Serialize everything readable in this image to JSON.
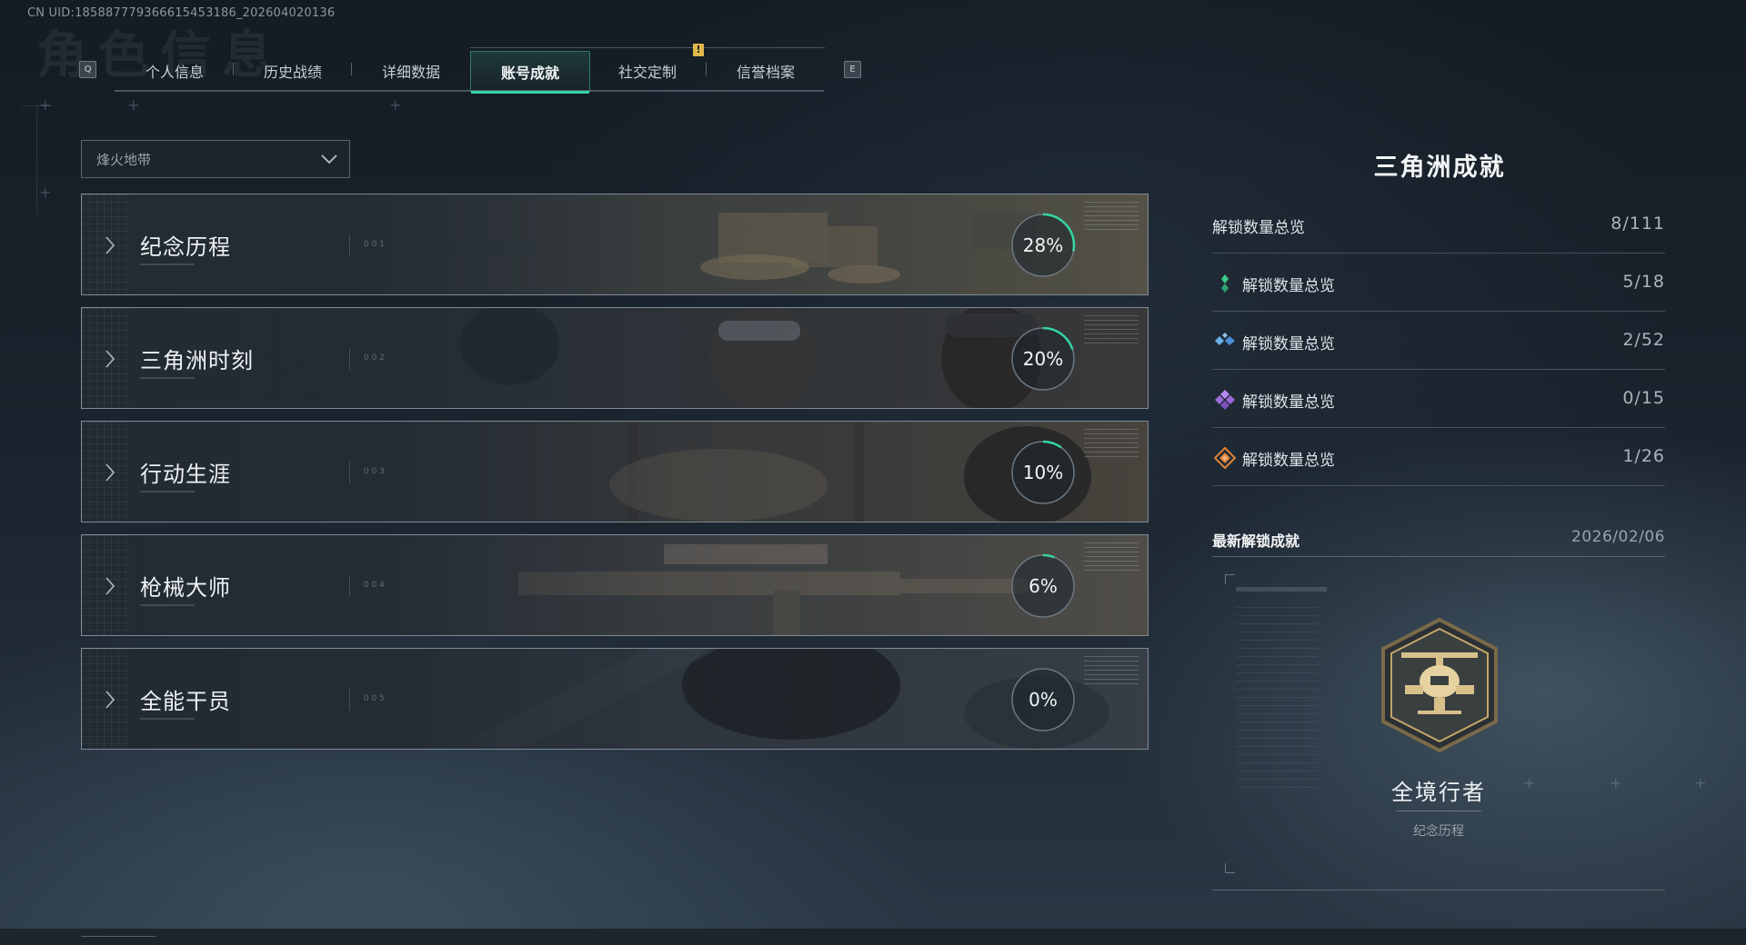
{
  "header": {
    "uid_text": "CN UID:1858877793666154531​86_202604020136",
    "page_title_watermark": "角色信息",
    "prev_key": "Q",
    "next_key": "E",
    "notice_mark": "!"
  },
  "tabs": [
    {
      "label": "个人信息",
      "active": false
    },
    {
      "label": "历史战绩",
      "active": false
    },
    {
      "label": "详细数据",
      "active": false
    },
    {
      "label": "账号成就",
      "active": true
    },
    {
      "label": "社交定制",
      "active": false
    },
    {
      "label": "信誉档案",
      "active": false
    }
  ],
  "filter": {
    "selected": "烽火地带",
    "icon": "chevron-down-icon"
  },
  "categories": [
    {
      "name": "纪念历程",
      "index": "0 0 1",
      "percent": 28,
      "percent_label": "28%"
    },
    {
      "name": "三角洲时刻",
      "index": "0 0 2",
      "percent": 20,
      "percent_label": "20%"
    },
    {
      "name": "行动生涯",
      "index": "0 0 3",
      "percent": 10,
      "percent_label": "10%"
    },
    {
      "name": "枪械大师",
      "index": "0 0 4",
      "percent": 6,
      "percent_label": "6%"
    },
    {
      "name": "全能干员",
      "index": "0 0 5",
      "percent": 0,
      "percent_label": "0%"
    }
  ],
  "panel": {
    "title": "三角洲成就",
    "stats": [
      {
        "label": "解锁数量总览",
        "value": "8/111",
        "icon": "none",
        "color": ""
      },
      {
        "label": "解锁数量总览",
        "value": "5/18",
        "icon": "green-tier-icon",
        "color": "#3fc98a"
      },
      {
        "label": "解锁数量总览",
        "value": "2/52",
        "icon": "blue-tier-icon",
        "color": "#4a8fd6"
      },
      {
        "label": "解锁数量总览",
        "value": "0/15",
        "icon": "purple-tier-icon",
        "color": "#9a6ad8"
      },
      {
        "label": "解锁数量总览",
        "value": "1/26",
        "icon": "orange-tier-icon",
        "color": "#e0843a"
      }
    ],
    "latest_title": "最新解锁成就",
    "latest_date": "2026/02/06",
    "latest_achievement": {
      "name": "全境行者",
      "category": "纪念历程",
      "icon": "helicopter-badge-icon"
    }
  },
  "colors": {
    "accent": "#35d6a2",
    "ring_track": "#6c7780"
  }
}
